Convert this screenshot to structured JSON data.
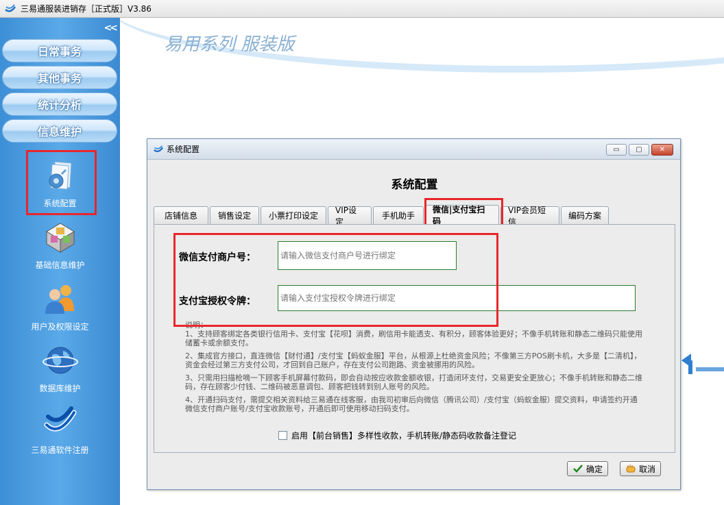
{
  "app": {
    "title": "三易通服装进销存［正式版］V3.86"
  },
  "sidebar": {
    "collapse_label": "<<",
    "nav_buttons": [
      {
        "label": "日常事务"
      },
      {
        "label": "其他事务"
      },
      {
        "label": "统计分析"
      },
      {
        "label": "信息维护"
      }
    ],
    "items": [
      {
        "label": "系统配置",
        "icon": "settings-document-icon"
      },
      {
        "label": "基础信息维护",
        "icon": "cubes-icon"
      },
      {
        "label": "用户及权限设定",
        "icon": "users-icon"
      },
      {
        "label": "数据库维护",
        "icon": "globe-icon"
      },
      {
        "label": "三易通软件注册",
        "icon": "brand-logo-icon"
      }
    ]
  },
  "main": {
    "brand_text": "易用系列 服装版"
  },
  "dialog": {
    "title": "系统配置",
    "heading": "系统配置",
    "window_buttons": {
      "minimize": "▭",
      "restore": "▢",
      "close": "✕"
    },
    "tabs": [
      {
        "label": "店铺信息"
      },
      {
        "label": "销售设定"
      },
      {
        "label": "小票打印设定"
      },
      {
        "label": "VIP设定"
      },
      {
        "label": "手机助手"
      },
      {
        "label": "微信|支付宝扫码",
        "active": true
      },
      {
        "label": "VIP会员短信"
      },
      {
        "label": "编码方案"
      }
    ],
    "wechat_label": "微信支付商户号：",
    "wechat_placeholder": "请输入微信支付商户号进行绑定",
    "alipay_label": "支付宝授权令牌：",
    "alipay_placeholder": "请输入支付宝授权令牌进行绑定",
    "notes_title": "说明：",
    "notes": [
      "1、支持顾客绑定各类银行信用卡、支付宝【花呗】消费，刷信用卡能透支、有积分，顾客体验更好；不像手机转账和静态二维码只能使用储蓄卡或余额支付。",
      "2、集成官方接口，直连微信【财付通】/支付宝【蚂蚁金服】平台，从根源上杜绝资金风险；不像第三方POS刷卡机，大多是【二清机】，资金会经过第三方支付公司，才回到自己账户，存在支付公司跑路、资金被挪用的风险。",
      "3、只需用扫描枪嘀一下顾客手机屏幕付款码，即会自动按应收款金额收银，打造闭环支付，交易更安全更放心；不像手机转账和静态二维码，存在顾客少付钱、二维码被恶意调包、顾客把钱转到别人账号的风险。",
      "4、开通扫码支付，需提交相关资料给三易通在线客服，由我司初审后向微信（腾讯公司）/支付宝（蚂蚁金服）提交资料，申请签约开通微信支付商户账号/支付宝收款账号，开通后即可使用移动扫码支付。"
    ],
    "checkbox_label": "启用【前台销售】多样性收款，手机转账/静态码收款备注登记",
    "checkbox_checked": false,
    "ok_label": "确定",
    "cancel_label": "取消"
  },
  "colors": {
    "highlight": "#e8262b",
    "sidebar": "#4a9be0",
    "input_border": "#2b7a2b"
  }
}
